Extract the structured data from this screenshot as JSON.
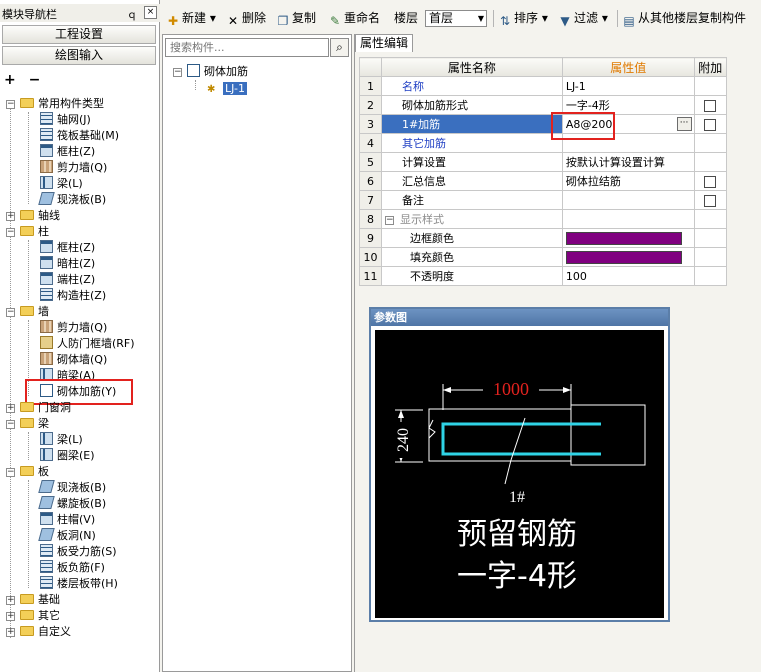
{
  "nav": {
    "title": "模块导航栏",
    "pin": "ｑ",
    "close": "×",
    "btn_project": "工程设置",
    "btn_drawing": "绘图输入",
    "tools": "+ −",
    "tree": {
      "common": "常用构件类型",
      "common_items": [
        "轴网(J)",
        "筏板基础(M)",
        "框柱(Z)",
        "剪力墙(Q)",
        "梁(L)",
        "现浇板(B)"
      ],
      "axis": "轴线",
      "column": "柱",
      "column_items": [
        "框柱(Z)",
        "暗柱(Z)",
        "端柱(Z)",
        "构造柱(Z)"
      ],
      "wall": "墙",
      "wall_items": [
        "剪力墙(Q)",
        "人防门框墙(RF)",
        "砌体墙(Q)",
        "暗梁(A)",
        "砌体加筋(Y)"
      ],
      "door": "门窗洞",
      "beam": "梁",
      "beam_items": [
        "梁(L)",
        "圈梁(E)"
      ],
      "slab": "板",
      "slab_items": [
        "现浇板(B)",
        "螺旋板(B)",
        "柱帽(V)",
        "板洞(N)",
        "板受力筋(S)",
        "板负筋(F)",
        "楼层板带(H)"
      ],
      "foundation": "基础",
      "other": "其它",
      "custom": "自定义"
    }
  },
  "toolbar": {
    "new": "新建",
    "delete": "删除",
    "copy": "复制",
    "rename": "重命名",
    "floor_label": "楼层",
    "floor_value": "首层",
    "sort": "排序",
    "filter": "过滤",
    "copy_from_floor": "从其他楼层复制构件"
  },
  "middle": {
    "search_placeholder": "搜索构件...",
    "tree_root": "砌体加筋",
    "tree_item": "LJ-1"
  },
  "props": {
    "tab": "属性编辑",
    "col_name": "属性名称",
    "col_value": "属性值",
    "col_extra": "附加",
    "rows": [
      {
        "num": "1",
        "name": "名称",
        "value": "LJ-1"
      },
      {
        "num": "2",
        "name": "砌体加筋形式",
        "value": "一字-4形"
      },
      {
        "num": "3",
        "name": "1#加筋",
        "value": "A8@200"
      },
      {
        "num": "4",
        "name": "其它加筋",
        "value": ""
      },
      {
        "num": "5",
        "name": "计算设置",
        "value": "按默认计算设置计算"
      },
      {
        "num": "6",
        "name": "汇总信息",
        "value": "砌体拉结筋"
      },
      {
        "num": "7",
        "name": "备注",
        "value": ""
      },
      {
        "num": "8",
        "name": "显示样式",
        "value": ""
      },
      {
        "num": "9",
        "name": "边框颜色",
        "value": ""
      },
      {
        "num": "10",
        "name": "填充颜色",
        "value": ""
      },
      {
        "num": "11",
        "name": "不透明度",
        "value": "100"
      }
    ],
    "ellipsis": "···",
    "collapse": "−"
  },
  "diagram": {
    "title": "参数图",
    "dim_length": "1000",
    "dim_width": "240",
    "rebar_label": "1#",
    "caption_line1": "预留钢筋",
    "caption_line2": "一字-4形"
  },
  "colors": {
    "accent_red": "#e2221e",
    "header_orange": "#e07a00",
    "link_blue": "#1f3fc4",
    "swatch_purple": "#800080",
    "rebar_cyan": "#2fd3e6"
  }
}
